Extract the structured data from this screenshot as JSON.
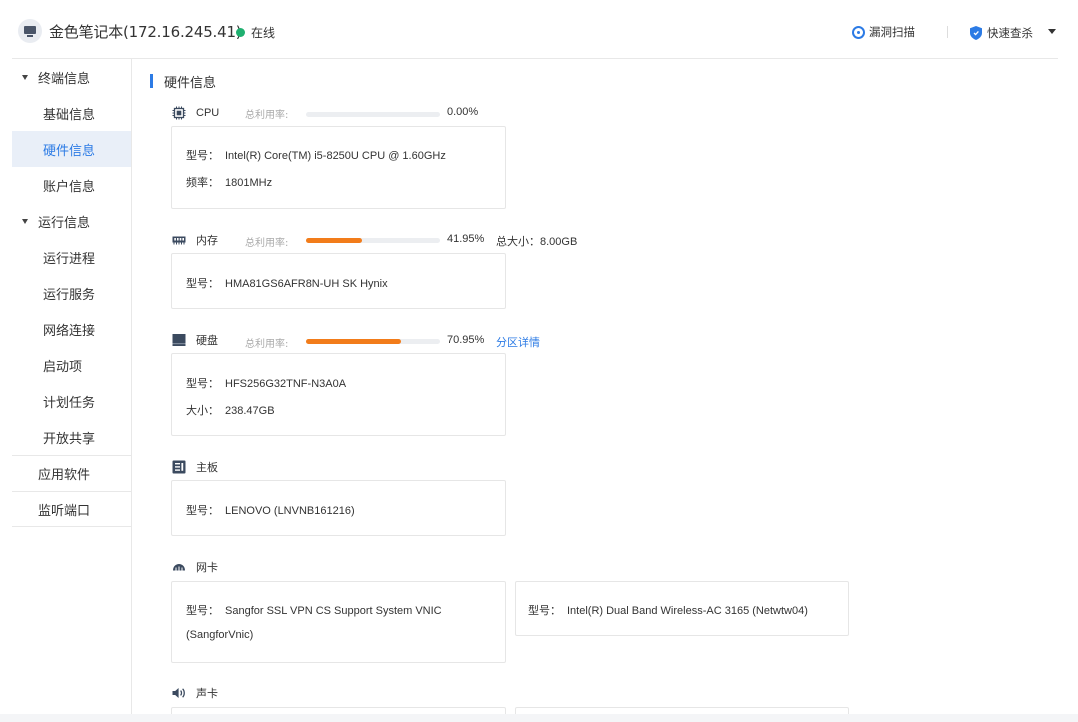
{
  "header": {
    "device_title": "金色笔记本(172.16.245.41)",
    "status": "在线",
    "status_color": "#1fb070",
    "scan_label": "漏洞扫描",
    "quick_kill_label": "快速查杀"
  },
  "sidebar": {
    "groups": [
      {
        "label": "终端信息",
        "items": [
          "基础信息",
          "硬件信息",
          "账户信息"
        ]
      },
      {
        "label": "运行信息",
        "items": [
          "运行进程",
          "运行服务",
          "网络连接",
          "启动项",
          "计划任务",
          "开放共享"
        ]
      }
    ],
    "flat_items": [
      "应用软件",
      "监听端口"
    ],
    "active_item": "硬件信息"
  },
  "main": {
    "section_title": "硬件信息",
    "usage_label": "总利用率:",
    "cpu": {
      "name": "CPU",
      "icon": "cpu-icon",
      "usage_pct": "0.00%",
      "usage_fraction": 0.0,
      "model_key": "型号：",
      "model": "Intel(R) Core(TM) i5-8250U CPU @ 1.60GHz",
      "freq_key": "频率：",
      "freq": "1801MHz"
    },
    "memory": {
      "name": "内存",
      "icon": "memory-icon",
      "usage_pct": "41.95%",
      "usage_fraction": 0.4195,
      "total_key": "总大小：",
      "total": "8.00GB",
      "model_key": "型号：",
      "model": "HMA81GS6AFR8N-UH SK Hynix"
    },
    "disk": {
      "name": "硬盘",
      "icon": "disk-icon",
      "usage_pct": "70.95%",
      "usage_fraction": 0.7095,
      "detail_link": "分区详情",
      "model_key": "型号：",
      "model": "HFS256G32TNF-N3A0A",
      "size_key": "大小：",
      "size": "238.47GB"
    },
    "motherboard": {
      "name": "主板",
      "icon": "motherboard-icon",
      "model_key": "型号：",
      "model": "LENOVO (LNVNB161216)"
    },
    "nic": {
      "name": "网卡",
      "icon": "network-card-icon",
      "model_key": "型号：",
      "cards": [
        {
          "line1": "Sangfor SSL VPN CS Support System VNIC",
          "line2": "(SangforVnic)"
        },
        {
          "line1": "Intel(R) Dual Band Wireless-AC 3165 (Netwtw04)"
        }
      ]
    },
    "sound": {
      "name": "声卡",
      "icon": "speaker-icon"
    },
    "fill_color": "#f27c1a",
    "accent_color": "#2c7be5"
  }
}
